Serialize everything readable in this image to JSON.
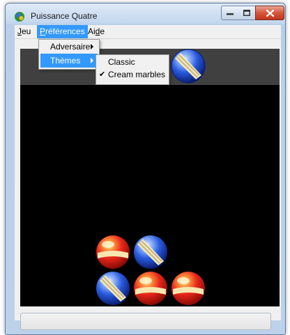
{
  "window": {
    "title": "Puissance Quatre",
    "icon": "puissance-app-icon",
    "controls": {
      "minimize": "minimize-icon",
      "maximize": "maximize-icon",
      "close": "close-icon"
    }
  },
  "menubar": {
    "items": [
      {
        "label": "Jeu",
        "underline": "J",
        "rest": "eu"
      },
      {
        "label": "Préférences",
        "underline": "P",
        "rest": "références"
      },
      {
        "label": "Aide",
        "pre": "Ai",
        "underline": "d",
        "rest": "e"
      }
    ]
  },
  "preferences_menu": {
    "items": [
      {
        "label": "Adversaire"
      },
      {
        "label": "Thèmes"
      }
    ]
  },
  "themes_menu": {
    "items": [
      {
        "label": "Classic",
        "checked": false
      },
      {
        "label": "Cream marbles",
        "checked": true
      }
    ]
  },
  "board": {
    "pending_piece": "blue",
    "pieces": [
      {
        "color": "red",
        "column": 3,
        "row": 2
      },
      {
        "color": "blue",
        "column": 4,
        "row": 2
      },
      {
        "color": "blue",
        "column": 3,
        "row": 1
      },
      {
        "color": "red",
        "column": 4,
        "row": 1
      },
      {
        "color": "red",
        "column": 5,
        "row": 1
      }
    ]
  },
  "colors": {
    "menu_highlight": "#3399ff",
    "board_background": "#000000",
    "board_top": "#404040",
    "red_marble": "#e8261a",
    "blue_marble": "#1f4fd1"
  }
}
